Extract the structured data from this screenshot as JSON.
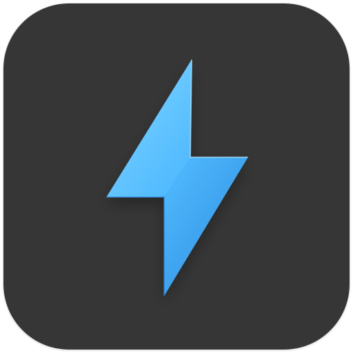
{
  "app_icon": {
    "icon_name": "lightning-bolt-icon",
    "background": "#363636",
    "bolt_color": "#4AB7FF",
    "bolt_highlight": "#7ED0FF",
    "bolt_shadow": "#2F8FE0"
  }
}
